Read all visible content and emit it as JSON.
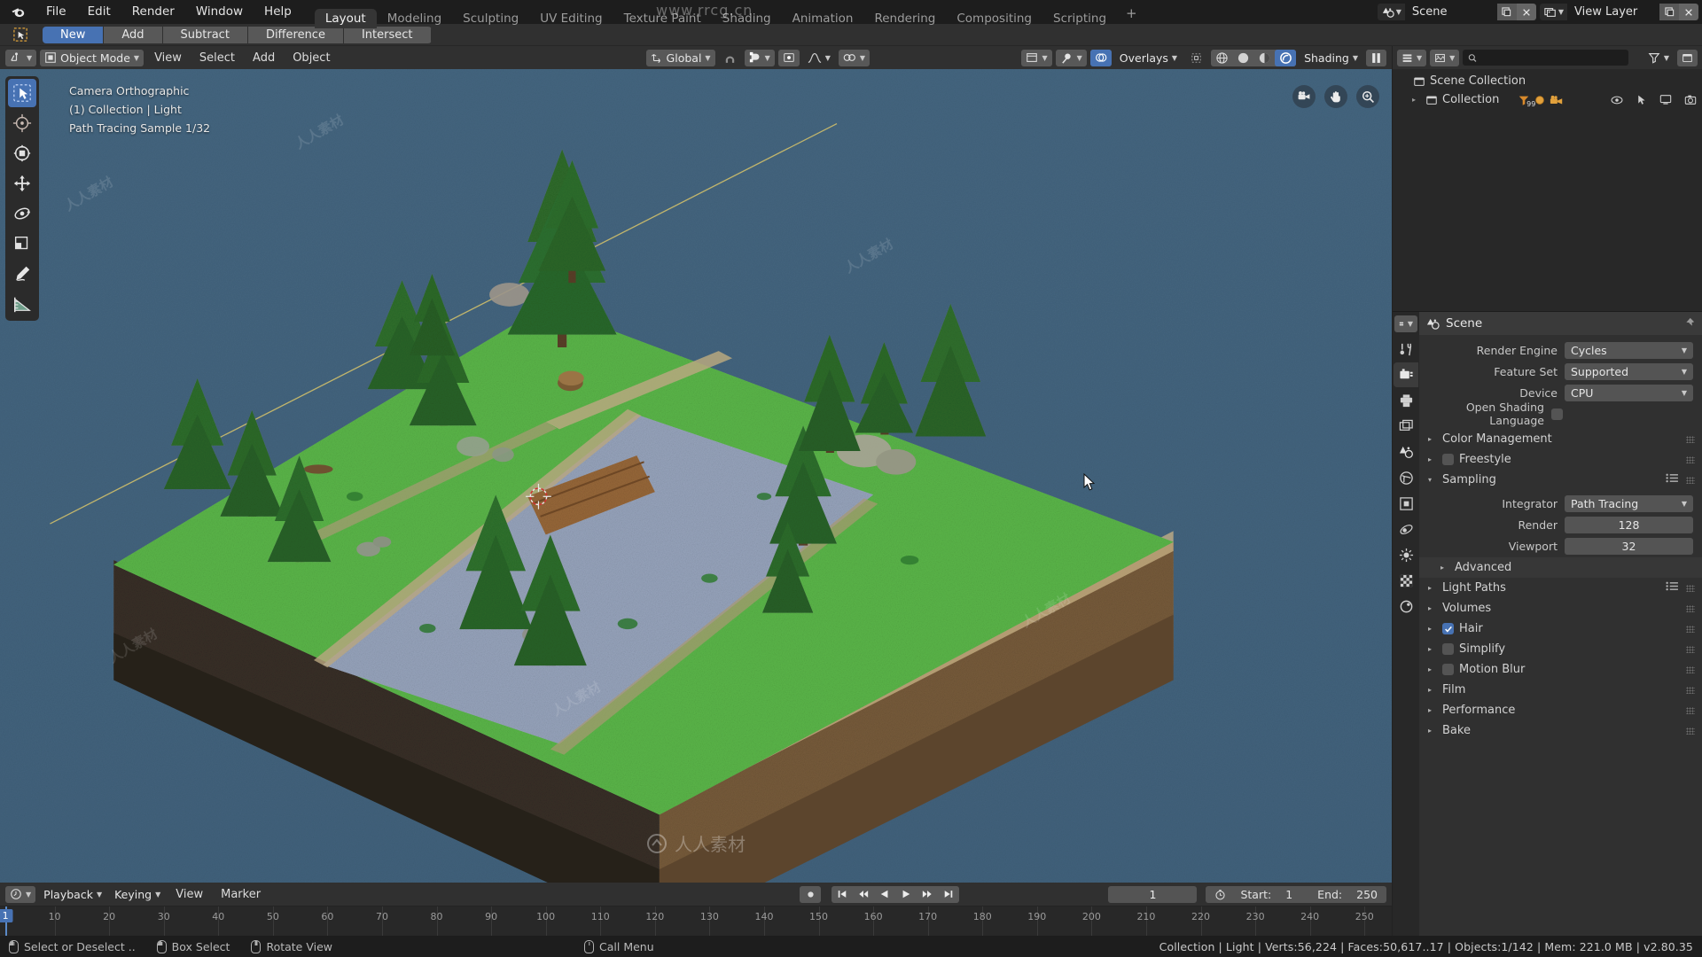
{
  "topbar": {
    "logo_icon": "blender-logo-icon",
    "menus": [
      "File",
      "Edit",
      "Render",
      "Window",
      "Help"
    ],
    "workspaces": [
      "Layout",
      "Modeling",
      "Sculpting",
      "UV Editing",
      "Texture Paint",
      "Shading",
      "Animation",
      "Rendering",
      "Compositing",
      "Scripting"
    ],
    "active_workspace": "Layout",
    "add_workspace_label": "+",
    "scene_selector": {
      "icon": "scene-icon",
      "value": "Scene",
      "new_icon": "duplicate-icon",
      "close_icon": "x-icon"
    },
    "viewlayer_selector": {
      "icon": "view-layer-icon",
      "value": "View Layer",
      "new_icon": "duplicate-icon",
      "close_icon": "x-icon"
    }
  },
  "tool_settings": {
    "tool_icon": "select-box-icon",
    "boolean_modes": [
      "New",
      "Add",
      "Subtract",
      "Difference",
      "Intersect"
    ],
    "active_boolean_mode": "New"
  },
  "viewport_header": {
    "editor_type_icon": "editor-type-icon",
    "mode_icon": "object-mode-icon",
    "mode": "Object Mode",
    "menus": [
      "View",
      "Select",
      "Add",
      "Object"
    ],
    "transform_orientation": {
      "icon": "orientation-icon",
      "value": "Global"
    },
    "snap_magnet_icon": "magnet-icon",
    "snap_icon": "snap-icon",
    "pivot_icon": "pivot-icon",
    "proportional_icon": "proportional-edit-icon",
    "proportional_falloff_icon": "falloff-curve-icon",
    "mirror_icon": "mirror-icon",
    "view_layer_icon": "view-layer-box-icon",
    "visibility_icon": "visibility-icon",
    "overlays_icon": "overlays-icon",
    "overlays_label": "Overlays",
    "gizmo_icon": "gizmo-icon",
    "shading_modes": [
      "wireframe-icon",
      "solid-icon",
      "material-preview-icon",
      "rendered-icon"
    ],
    "active_shading_index": 3,
    "shading_label": "Shading",
    "pause_icon": "pause-render-icon"
  },
  "viewport": {
    "overlay_lines": [
      "Camera Orthographic",
      "(1) Collection | Light",
      "Path Tracing Sample 1/32"
    ],
    "toolbar": [
      {
        "name": "tweak-select-tool",
        "icon": "cursor-box-icon",
        "active": true
      },
      {
        "name": "cursor-tool",
        "icon": "3d-cursor-icon",
        "active": false
      },
      {
        "name": "move-tool",
        "icon": "move-gizmo-icon",
        "active": false
      },
      {
        "name": "translate-tool",
        "icon": "arrows-move-icon",
        "active": false
      },
      {
        "name": "rotate-tool",
        "icon": "rotate-icon",
        "active": false
      },
      {
        "name": "scale-tool",
        "icon": "scale-icon",
        "active": false
      },
      {
        "name": "annotate-tool",
        "icon": "pencil-icon",
        "active": false
      },
      {
        "name": "measure-tool",
        "icon": "ruler-icon",
        "active": false
      }
    ],
    "nav_gizmos": [
      "camera-view-icon",
      "pan-view-icon",
      "zoom-view-icon"
    ],
    "background_color": "#42637f",
    "ground_green": "#56c04a",
    "ground_dirt": "#6a5038",
    "water_color": "#8b9ab5",
    "tree_green": "#2d6b2a"
  },
  "timeline": {
    "editor_icon": "timeline-icon",
    "menus": [
      "Playback",
      "Keying",
      "View",
      "Marker"
    ],
    "transport": [
      "record-icon",
      "jump-start-icon",
      "prev-keyframe-icon",
      "play-reverse-icon",
      "play-icon",
      "next-keyframe-icon",
      "jump-end-icon"
    ],
    "current_frame": "1",
    "clock_icon": "clock-icon",
    "start_label": "Start:",
    "start_value": "1",
    "end_label": "End:",
    "end_value": "250",
    "ruler_ticks": [
      10,
      20,
      30,
      40,
      50,
      60,
      70,
      80,
      90,
      100,
      110,
      120,
      130,
      140,
      150,
      160,
      170,
      180,
      190,
      200,
      210,
      220,
      230,
      240,
      250
    ],
    "playhead_frame": "1"
  },
  "outliner": {
    "display_mode_icon": "editor-outliner-icon",
    "filter_display_icon": "view-layer-icon",
    "search_placeholder": "",
    "search_icon": "search-icon",
    "filter_icon": "filter-funnel-icon",
    "new_collection_icon": "new-collection-icon",
    "rows": [
      {
        "label": "Scene Collection",
        "icon": "collection-box-icon",
        "indent": false,
        "disclosure": ""
      },
      {
        "label": "Collection",
        "icon": "collection-box-icon",
        "indent": true,
        "disclosure": "▸",
        "badges": [
          "filter-99-icon",
          "mesh-data-icon",
          "camera-data-icon"
        ],
        "count": "99"
      }
    ],
    "row_right_icons": [
      "eye-icon",
      "cursor-select-icon",
      "screen-icon",
      "camera-render-icon"
    ]
  },
  "properties": {
    "tabs": [
      {
        "name": "tool-tab",
        "icon": "tool-wrench-icon",
        "active": false
      },
      {
        "name": "render-tab",
        "icon": "render-camera-icon",
        "active": true
      },
      {
        "name": "output-tab",
        "icon": "printer-icon",
        "active": false
      },
      {
        "name": "view-layer-tab",
        "icon": "images-icon",
        "active": false
      },
      {
        "name": "scene-tab",
        "icon": "scene-cone-icon",
        "active": false
      },
      {
        "name": "world-tab",
        "icon": "world-globe-icon",
        "active": false
      },
      {
        "name": "object-tab",
        "icon": "object-square-icon",
        "active": false
      },
      {
        "name": "physics-tab",
        "icon": "physics-orbit-icon",
        "active": false
      },
      {
        "name": "constraints-tab",
        "icon": "sun-icon",
        "active": false
      },
      {
        "name": "material-tab",
        "icon": "checker-icon",
        "active": false
      },
      {
        "name": "texture-tab",
        "icon": "texture-icon",
        "active": false
      }
    ],
    "breadcrumb_icon": "scene-icon",
    "breadcrumb": "Scene",
    "pin_icon": "pin-icon",
    "fields": [
      {
        "label": "Render Engine",
        "value": "Cycles",
        "type": "dropdown"
      },
      {
        "label": "Feature Set",
        "value": "Supported",
        "type": "dropdown"
      },
      {
        "label": "Device",
        "value": "CPU",
        "type": "dropdown"
      },
      {
        "label": "Open Shading Language",
        "value": "",
        "type": "checkbox",
        "checked": false
      }
    ],
    "panels": [
      {
        "label": "Color Management",
        "open": false,
        "checkbox": null,
        "shaded": false
      },
      {
        "label": "Freestyle",
        "open": false,
        "checkbox": false,
        "shaded": false
      },
      {
        "label": "Sampling",
        "open": true,
        "checkbox": null,
        "shaded": false,
        "has_list_icon": true
      }
    ],
    "sampling": {
      "integrator_label": "Integrator",
      "integrator_value": "Path Tracing",
      "render_label": "Render",
      "render_value": "128",
      "viewport_label": "Viewport",
      "viewport_value": "32",
      "advanced_label": "Advanced"
    },
    "panels_bottom": [
      {
        "label": "Light Paths",
        "checkbox": null,
        "has_list_icon": true
      },
      {
        "label": "Volumes",
        "checkbox": null
      },
      {
        "label": "Hair",
        "checkbox": true
      },
      {
        "label": "Simplify",
        "checkbox": false
      },
      {
        "label": "Motion Blur",
        "checkbox": false
      },
      {
        "label": "Film",
        "checkbox": null
      },
      {
        "label": "Performance",
        "checkbox": null
      },
      {
        "label": "Bake",
        "checkbox": null
      }
    ]
  },
  "statusbar": {
    "hints": [
      {
        "mouse": "left",
        "label": "Select or Deselect .."
      },
      {
        "mouse": "left-drag",
        "label": "Box Select"
      },
      {
        "mouse": "middle",
        "label": "Rotate View"
      },
      {
        "mouse": "right",
        "label": "Call Menu"
      }
    ],
    "stats": "Collection | Light | Verts:56,224 | Faces:50,617..17 | Objects:1/142 | Mem: 221.0 MB | v2.80.35"
  },
  "watermarks": {
    "url": "www.rrcg.cn",
    "tile_text": "人人素材",
    "center_text": "人人素材"
  }
}
